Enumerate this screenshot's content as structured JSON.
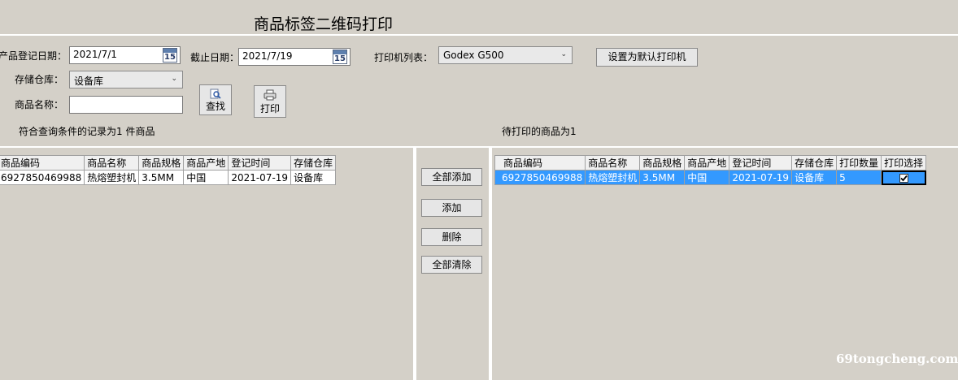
{
  "window": {
    "title": "商品标签二维码打印"
  },
  "filters": {
    "register_date_label": "产品登记日期：",
    "register_date_value": "2021/7/1",
    "end_date_label": "截止日期：",
    "end_date_value": "2021/7/19",
    "calendar_day": "15",
    "printer_label": "打印机列表：",
    "printer_value": "Godex G500",
    "set_default_label": "设置为默认打印机",
    "warehouse_label": "存储仓库：",
    "warehouse_value": "设备库",
    "product_name_label": "商品名称：",
    "product_name_value": "",
    "search_label": "查找",
    "print_label": "打印"
  },
  "status": {
    "left_count": "符合查询条件的记录为1 件商品",
    "right_count": "待打印的商品为1"
  },
  "left_table": {
    "columns": [
      "商品编码",
      "商品名称",
      "商品规格",
      "商品产地",
      "登记时间",
      "存储仓库"
    ],
    "rows": [
      [
        "6927850469988",
        "热熔塑封机",
        "3.5MM",
        "中国",
        "2021-07-19",
        "设备库"
      ]
    ]
  },
  "middle_buttons": {
    "add_all": "全部添加",
    "add": "添加",
    "delete": "删除",
    "clear_all": "全部清除"
  },
  "right_table": {
    "columns": [
      "商品编码",
      "商品名称",
      "商品规格",
      "商品产地",
      "登记时间",
      "存储仓库",
      "打印数量",
      "打印选择"
    ],
    "rows": [
      [
        "6927850469988",
        "热熔塑封机",
        "3.5MM",
        "中国",
        "2021-07-19",
        "设备库",
        "5"
      ]
    ],
    "selected_checked": true,
    "selection_color": "#3399ff"
  },
  "watermark": "69tongcheng.com"
}
